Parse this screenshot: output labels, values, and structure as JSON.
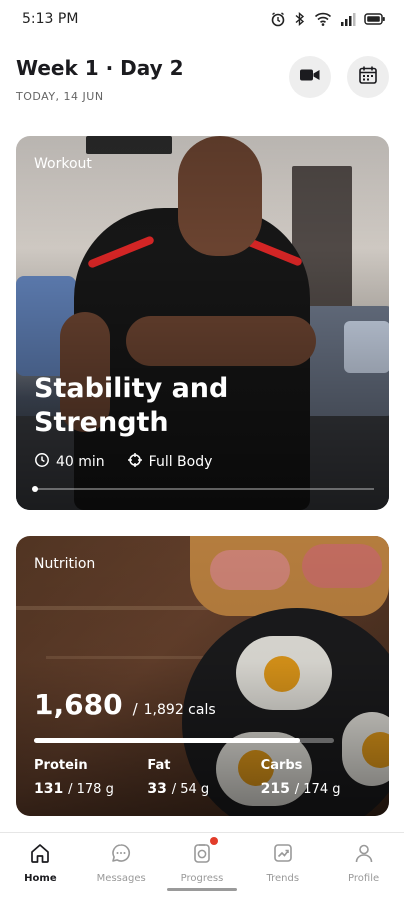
{
  "status_bar": {
    "time": "5:13 PM",
    "icons": [
      "alarm-icon",
      "bluetooth-icon",
      "wifi-icon",
      "signal-icon",
      "battery-icon"
    ]
  },
  "header": {
    "title": "Week 1 · Day 2",
    "date": "TODAY, 14 JUN",
    "buttons": [
      "video-camera-icon",
      "calendar-icon"
    ]
  },
  "workout_card": {
    "label": "Workout",
    "title": "Stability and Strength",
    "duration": "40 min",
    "focus": "Full Body",
    "carousel_position": 0
  },
  "nutrition_card": {
    "label": "Nutrition",
    "calories": "1,680",
    "separator": "/",
    "calorie_goal": "1,892 cals",
    "calorie_progress": 0.888,
    "macros": [
      {
        "name": "Protein",
        "value": "131",
        "goal": "/ 178 g"
      },
      {
        "name": "Fat",
        "value": "33",
        "goal": "/ 54 g"
      },
      {
        "name": "Carbs",
        "value": "215",
        "goal": "/ 174 g"
      }
    ]
  },
  "bottom_nav": {
    "items": [
      {
        "label": "Home",
        "icon": "home-icon",
        "active": true
      },
      {
        "label": "Messages",
        "icon": "chat-icon",
        "active": false
      },
      {
        "label": "Progress",
        "icon": "progress-icon",
        "active": false,
        "badge": true
      },
      {
        "label": "Trends",
        "icon": "trends-icon",
        "active": false
      },
      {
        "label": "Profile",
        "icon": "profile-icon",
        "active": false
      }
    ]
  },
  "colors": {
    "accent_badge": "#e23c2a",
    "text_primary": "#1b1b1f",
    "text_secondary": "#666666"
  }
}
